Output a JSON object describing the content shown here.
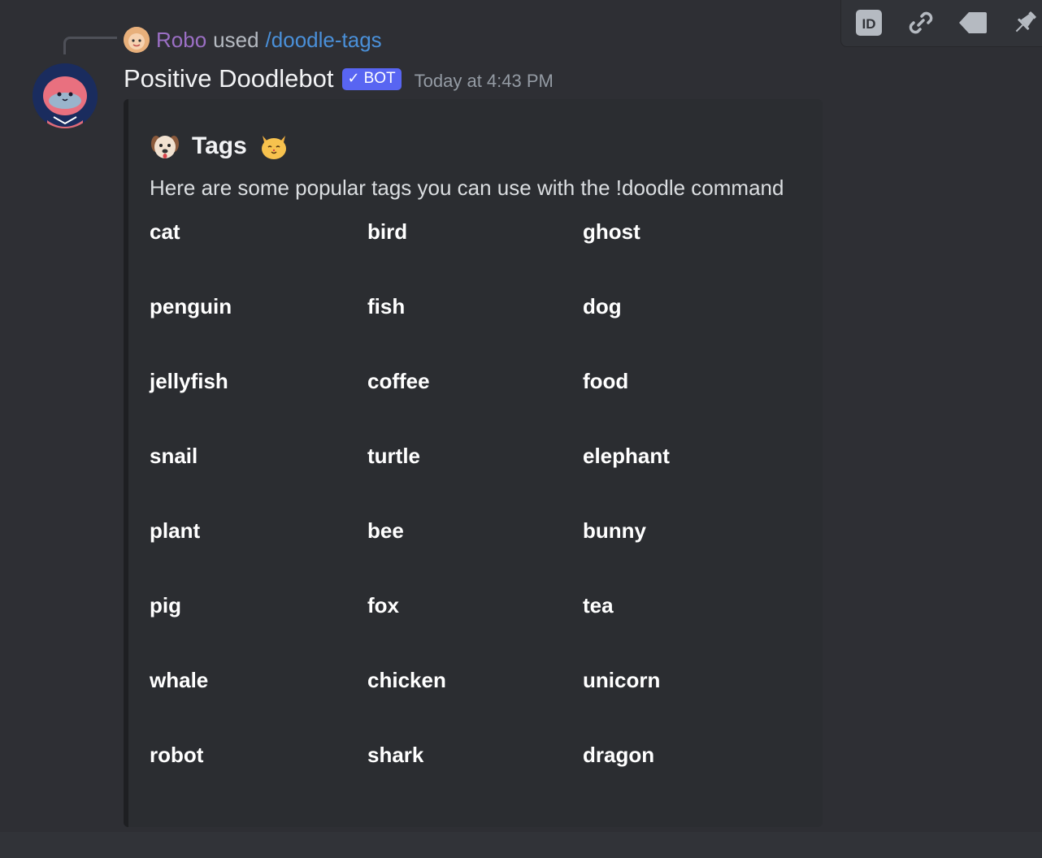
{
  "reply": {
    "username": "Robo",
    "used_text": "used",
    "command": "/doodle-tags"
  },
  "message": {
    "author": "Positive Doodlebot",
    "badge_check": "✓",
    "badge_label": "BOT",
    "timestamp": "Today at 4:43 PM"
  },
  "embed": {
    "title": "Tags",
    "title_left_icon": "dog-face-icon",
    "title_right_icon": "cat-face-icon",
    "description": "Here are some popular tags you can use with the !doodle command",
    "tags": [
      [
        "cat",
        "bird",
        "ghost"
      ],
      [
        "penguin",
        "fish",
        "dog"
      ],
      [
        "jellyfish",
        "coffee",
        "food"
      ],
      [
        "snail",
        "turtle",
        "elephant"
      ],
      [
        "plant",
        "bee",
        "bunny"
      ],
      [
        "pig",
        "fox",
        "tea"
      ],
      [
        "whale",
        "chicken",
        "unicorn"
      ],
      [
        "robot",
        "shark",
        "dragon"
      ]
    ]
  },
  "toolbar": {
    "icons": [
      "id-icon",
      "link-icon",
      "tag-icon",
      "pin-icon"
    ]
  },
  "colors": {
    "background": "#313338",
    "message_bg": "#2e2f34",
    "embed_bg": "#2b2d31",
    "bot_badge": "#5865f2",
    "reply_username": "#9b6fc4",
    "command_link": "#4a90d9"
  }
}
